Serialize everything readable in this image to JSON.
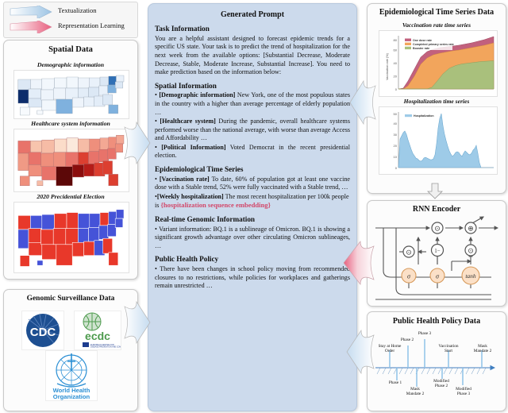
{
  "legend": {
    "items": [
      {
        "label": "Textualization",
        "icon": "arrow-right-blue-icon",
        "color": "#b9d4ea"
      },
      {
        "label": "Representation Learning",
        "icon": "arrow-right-red-icon",
        "color": "#e8607f"
      }
    ]
  },
  "spatial": {
    "title": "Spatial Data",
    "maps": [
      {
        "caption": "Demographic information",
        "palette": "blues"
      },
      {
        "caption": "Healthcare system information",
        "palette": "reds"
      },
      {
        "caption": "2020 Precidential Election",
        "palette": "red-blue"
      }
    ]
  },
  "genomic": {
    "title": "Genomic Surveillance Data",
    "logos": [
      {
        "name": "cdc-logo",
        "label": "CDC"
      },
      {
        "name": "ecdc-logo",
        "label": "ecdc",
        "sublabel": "EUROPEAN CENTRE FOR DISEASE PREVENTION AND CONTROL"
      },
      {
        "name": "who-logo",
        "label": "World Health\nOrganization"
      }
    ]
  },
  "prompt": {
    "title": "Generated Prompt",
    "sections": [
      {
        "heading": "Task Information",
        "body": "You are a helpful assistant designed to forecast epidemic trends for a specific US state. Your task is to predict the trend of hospitalization for the next week from the available options: [Substantial Decrease, Moderate Decrease, Stable, Moderate Increase, Substantial Increase]. You need to make prediction based on the information below:"
      },
      {
        "heading": "Spatial Information",
        "bullets": [
          {
            "tag": "[Demographic information]",
            "text": " New York, one of the most populous states in the country with a higher than average percentage of elderly population …"
          },
          {
            "tag": "[Healthcare system]",
            "text": " During the pandemic, overall healthcare systems performed worse than the national average, with worse than average Access and Affordability …"
          },
          {
            "tag": "[Political Information]",
            "text": " Voted Democrat in the recent presidential election."
          }
        ]
      },
      {
        "heading": "Epidemiological Time Series",
        "bullets": [
          {
            "tag": "[Vaccination rate]",
            "text": " To date, 60% of population got at least one vaccine dose with a Stable trend, 52% were fully vaccinated with a Stable trend, …"
          },
          {
            "tag": "[Weekly hospitalization]",
            "text": " The most recent hospitalization per 100k people is ",
            "embed": "{hospitalization sequence embedding}"
          }
        ]
      },
      {
        "heading": "Real-time Genomic Information",
        "bullets": [
          {
            "tag": "",
            "text": "Variant information: BQ.1 is a sublineage of Omicron. BQ.1 is showing a significant growth advantage over other circulating Omicron sublineages, …"
          }
        ]
      },
      {
        "heading": "Public Health Policy",
        "bullets": [
          {
            "tag": "",
            "text": "There have been changes in school policy moving from recommended closures to no restrictions, while policies for workplaces and gatherings remain unrestricted …"
          }
        ]
      }
    ],
    "embed_color": "#d2486a"
  },
  "epi": {
    "title": "Epidemiological Time Series Data",
    "chart1_caption": "Vaccination rate time series",
    "chart2_caption": "Hospitalization time series"
  },
  "rnn": {
    "title": "RNN Encoder",
    "nodes": [
      {
        "name": "multiply-node-1",
        "glyph": "⊙"
      },
      {
        "name": "multiply-node-2",
        "glyph": "⊙"
      },
      {
        "name": "add-node",
        "glyph": "⊕"
      },
      {
        "name": "one-minus-node",
        "glyph": "1−"
      },
      {
        "name": "multiply-node-3",
        "glyph": "⊙"
      },
      {
        "name": "sigmoid-gate-1",
        "glyph": "σ"
      },
      {
        "name": "sigmoid-gate-2",
        "glyph": "σ"
      },
      {
        "name": "tanh-gate",
        "glyph": "tanh"
      }
    ]
  },
  "policy": {
    "title": "Public Health Policy Data",
    "events_above": [
      {
        "label": "Stay at Home\nOrder",
        "x": 13
      },
      {
        "label": "Phase 2",
        "x": 27
      },
      {
        "label": "Phase 3",
        "x": 42
      },
      {
        "label": "Vaccination\nStart",
        "x": 61
      },
      {
        "label": "Mask\nMandate 2",
        "x": 86
      }
    ],
    "events_below": [
      {
        "label": "Phase 1",
        "x": 20
      },
      {
        "label": "Mask\nMandate 2",
        "x": 35
      },
      {
        "label": "Modified\nPhase 2",
        "x": 55
      },
      {
        "label": "Modified\nPhase 3",
        "x": 71
      }
    ]
  },
  "chart_data": [
    {
      "type": "area",
      "title": "Vaccination rate time series",
      "xlabel": "",
      "ylabel": "Vaccination rate (%)",
      "ylim": [
        0,
        90
      ],
      "yticks": [
        0,
        20,
        40,
        60,
        80
      ],
      "grid": false,
      "legend_position": "top-left",
      "stacked": true,
      "series": [
        {
          "name": "One dose rate",
          "color": "#c2617d",
          "values": [
            0,
            2,
            12,
            30,
            48,
            57,
            61,
            64,
            66,
            68,
            70,
            72,
            74,
            77,
            80,
            84,
            88,
            90
          ]
        },
        {
          "name": "Completed primary series rate",
          "color": "#f2a55c",
          "values": [
            0,
            0,
            5,
            20,
            38,
            48,
            53,
            56,
            58,
            60,
            62,
            64,
            66,
            68,
            70,
            73,
            76,
            79
          ]
        },
        {
          "name": "Booster rate",
          "color": "#a9c07c",
          "values": [
            0,
            0,
            0,
            0,
            0,
            0,
            2,
            10,
            22,
            31,
            36,
            39,
            41,
            43,
            44,
            45,
            46,
            47
          ]
        }
      ]
    },
    {
      "type": "area",
      "title": "Hospitalization time series",
      "xlabel": "",
      "ylabel": "",
      "ylim": [
        0,
        52
      ],
      "yticks": [
        0,
        10,
        20,
        30,
        40,
        50
      ],
      "grid": false,
      "legend_position": "top-left",
      "series": [
        {
          "name": "Hospitalization",
          "color": "#9ecbe8",
          "values": [
            0,
            26,
            29,
            31,
            33,
            30,
            25,
            21,
            17,
            14,
            12,
            10,
            9,
            8,
            7,
            8,
            10,
            11,
            10,
            9,
            8,
            8,
            9,
            12,
            22,
            36,
            45,
            50,
            40,
            30,
            24,
            19,
            15,
            12,
            10,
            11,
            13,
            14,
            13,
            11,
            10,
            12,
            14,
            15,
            13,
            11,
            10,
            11,
            13,
            16,
            12,
            5,
            1
          ]
        }
      ]
    }
  ]
}
